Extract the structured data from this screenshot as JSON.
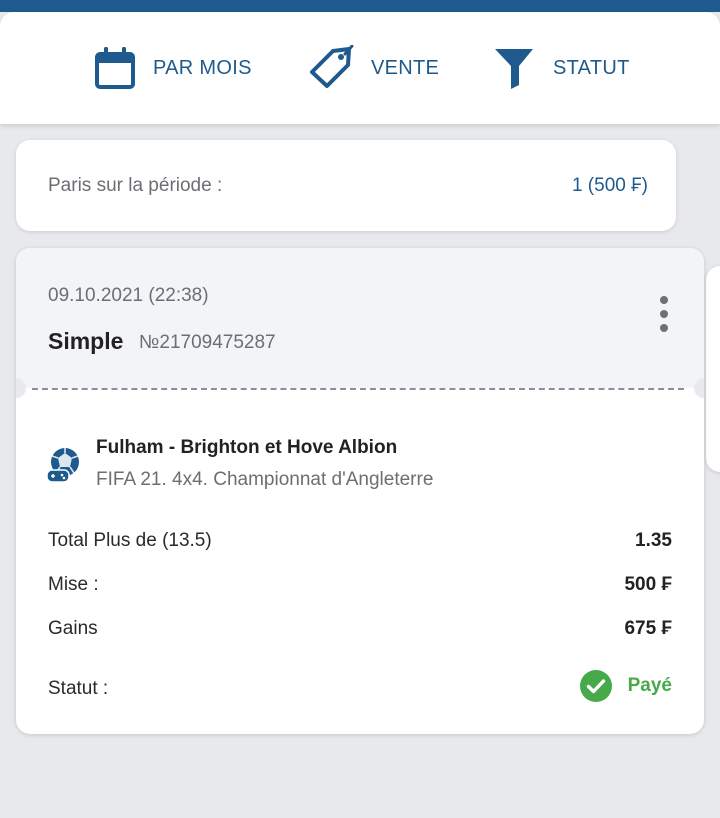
{
  "filters": {
    "monthly": {
      "label": "PAR MOIS",
      "icon": "calendar-icon"
    },
    "sale": {
      "label": "VENTE",
      "icon": "tag-icon"
    },
    "status": {
      "label": "STATUT",
      "icon": "filter-icon"
    }
  },
  "summary": {
    "label": "Paris sur la période :",
    "value": "1 (500 ₣)"
  },
  "bet": {
    "datetime": "09.10.2021 (22:38)",
    "type": "Simple",
    "number": "№21709475287",
    "menu_icon": "more-vertical-icon",
    "event": {
      "icon": "soccer-ball-icon",
      "title": "Fulham - Brighton et Hove Albion",
      "league": "FIFA 21. 4x4. Championnat d'Angleterre"
    },
    "rows": [
      {
        "label": "Total Plus de (13.5)",
        "value": "1.35"
      },
      {
        "label": "Mise :",
        "value": "500 ₣"
      },
      {
        "label": "Gains",
        "value": "675 ₣"
      }
    ],
    "status": {
      "label": "Statut :",
      "value": "Payé",
      "icon": "check-circle-icon",
      "color": "#47a94a"
    }
  },
  "colors": {
    "brand": "#1e5a8e",
    "paid": "#47a94a",
    "background": "#e8e9ec"
  }
}
